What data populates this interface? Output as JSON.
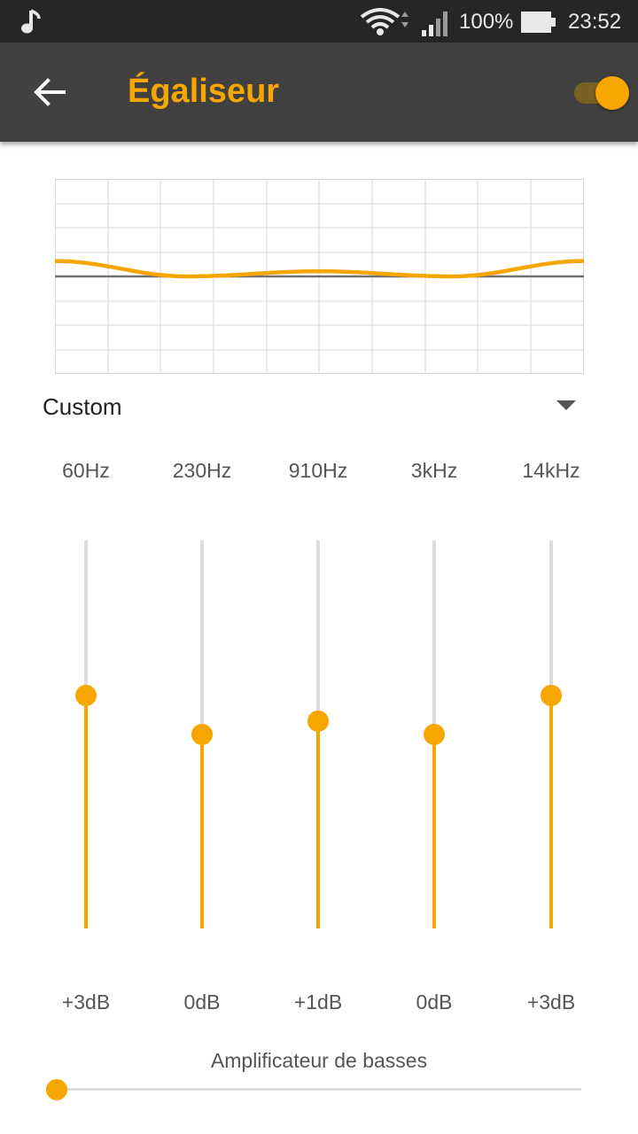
{
  "status_bar": {
    "battery_percent": "100%",
    "time": "23:52",
    "icons": [
      "music-note-icon",
      "wifi-icon",
      "signal-icon",
      "battery-icon"
    ]
  },
  "app_bar": {
    "title": "Égaliseur",
    "back_icon": "arrow-back-icon",
    "toggle_on": true
  },
  "colors": {
    "accent": "#f7a600",
    "appbar": "#404040",
    "statusbar": "#262626"
  },
  "preset": {
    "selected": "Custom"
  },
  "bands": [
    {
      "freq": "60Hz",
      "gain": "+3dB",
      "db": 3
    },
    {
      "freq": "230Hz",
      "gain": "0dB",
      "db": 0
    },
    {
      "freq": "910Hz",
      "gain": "+1dB",
      "db": 1
    },
    {
      "freq": "3kHz",
      "gain": "0dB",
      "db": 0
    },
    {
      "freq": "14kHz",
      "gain": "+3dB",
      "db": 3
    }
  ],
  "band_range_db": [
    -15,
    15
  ],
  "bass_boost": {
    "label": "Amplificateur de basses",
    "level": 0
  }
}
